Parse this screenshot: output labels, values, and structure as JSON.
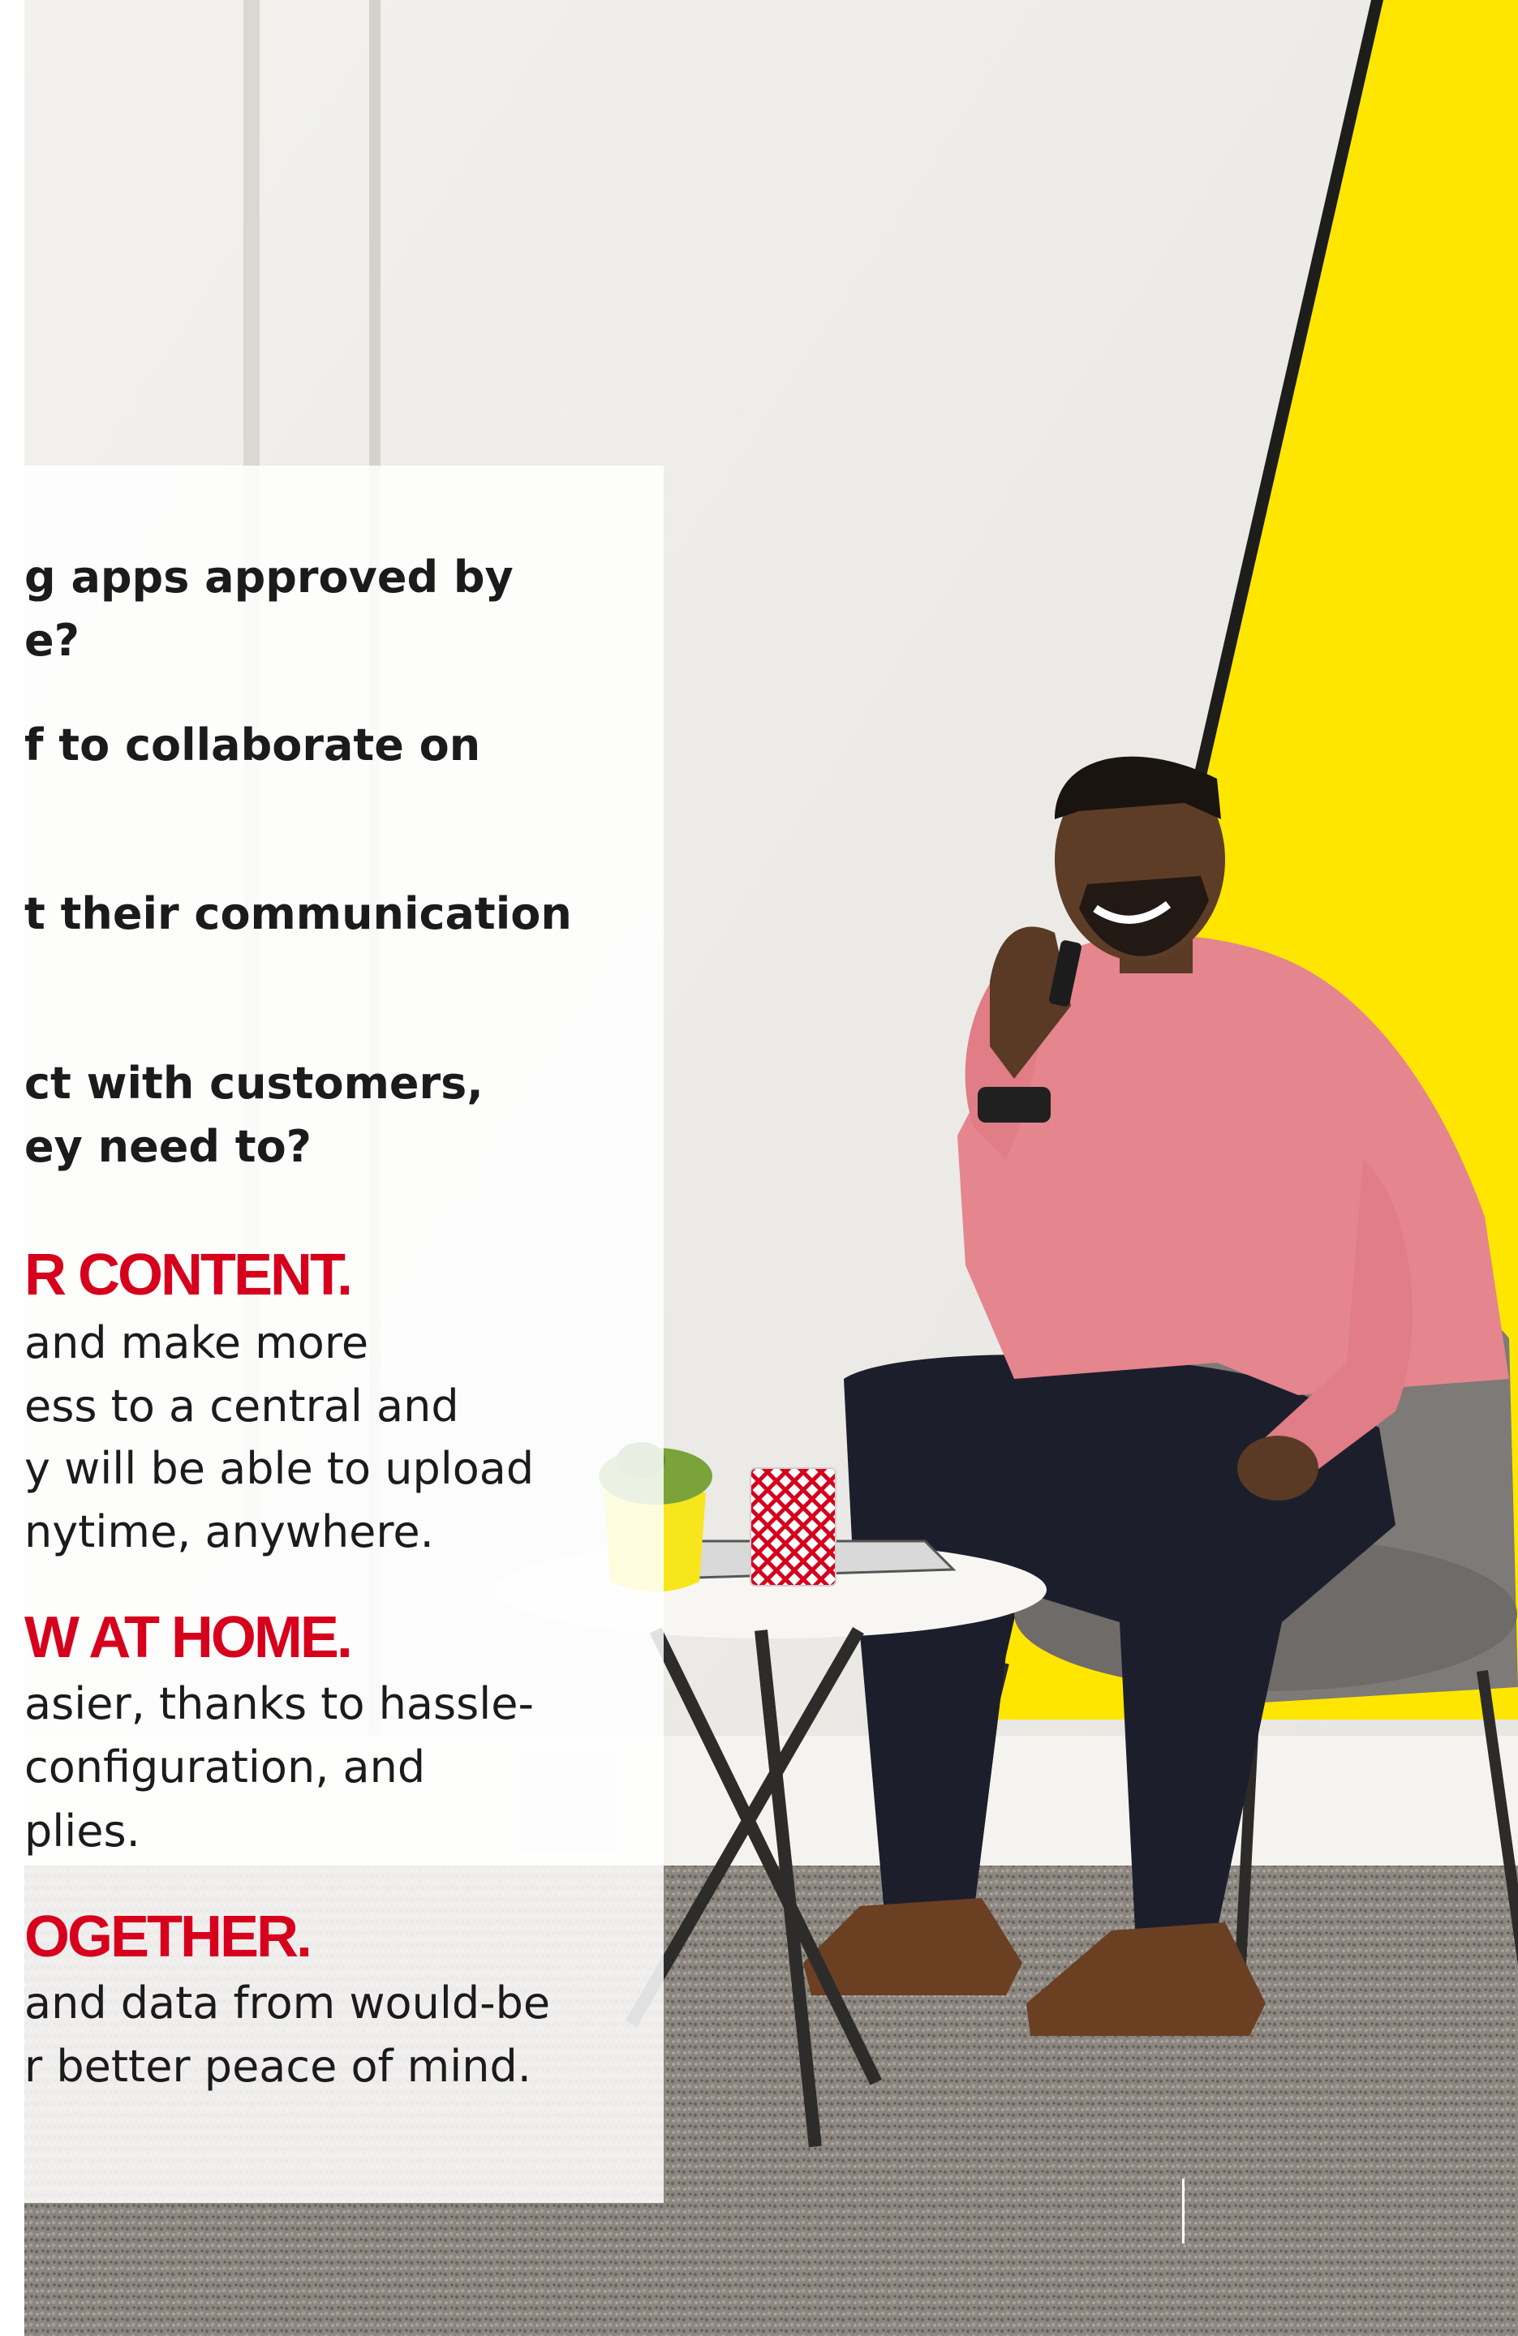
{
  "questions": [
    [
      "g apps approved by",
      "e?"
    ],
    [
      "f to collaborate on"
    ],
    [
      "t their communication"
    ],
    [
      "ct with customers,",
      "ey need to?"
    ]
  ],
  "sections": [
    {
      "heading": "R CONTENT.",
      "body": [
        "and make more",
        "ess to a central and",
        "y will be able to upload",
        "nytime, anywhere."
      ]
    },
    {
      "heading": "W AT HOME.",
      "body": [
        "asier, thanks to hassle-",
        "configuration, and",
        "plies."
      ]
    },
    {
      "heading": "OGETHER.",
      "body": [
        "and data from would-be",
        "r better peace of mind."
      ]
    }
  ],
  "colors": {
    "accent_red": "#d6001c",
    "accent_yellow": "#ffe600",
    "text_dark": "#1b1b1b"
  },
  "photo": {
    "description_icon": "man-on-phone-photo"
  }
}
